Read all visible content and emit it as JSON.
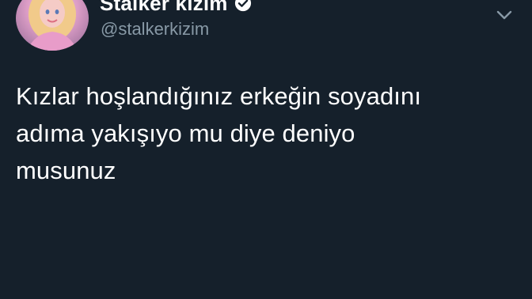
{
  "author": {
    "display_name": "Stalker kızım",
    "username": "@stalkerkizim",
    "verified_icon": "verified-badge-icon",
    "avatar_watermark": "Stalker kızım"
  },
  "menu": {
    "caret_icon": "chevron-down-icon"
  },
  "tweet": {
    "text": "Kızlar hoşlandığınız erkeğin soyadını\nadıma yakışıyo mu diye deniyo\nmusunuz"
  },
  "colors": {
    "background": "#15202b",
    "primary_text": "#ffffff",
    "secondary_text": "#8899a6"
  }
}
